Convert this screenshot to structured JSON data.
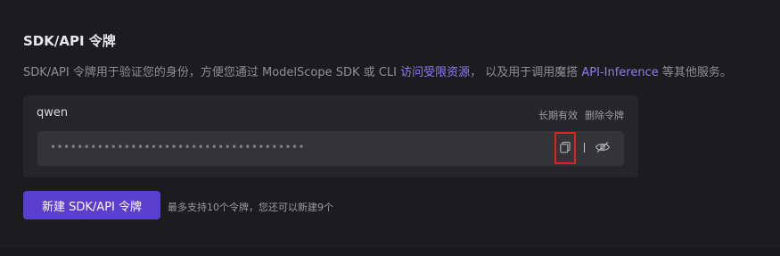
{
  "section": {
    "title": "SDK/API 令牌"
  },
  "description": {
    "part1": "SDK/API 令牌用于验证您的身份，方便您通过 ModelScope SDK 或 CLI ",
    "link1": "访问受限资源",
    "part2": "， 以及用于调用魔搭 ",
    "link2": "API-Inference",
    "part3": " 等其他服务。"
  },
  "token": {
    "name": "qwen",
    "validity_label": "长期有效",
    "delete_label": "删除令牌",
    "masked_value": "••••••••••••••••••••••••••••••••••••••"
  },
  "icons": {
    "copy": "copy-icon",
    "eye": "eye-off-icon"
  },
  "actions": {
    "new_button_label": "新建 SDK/API 令牌",
    "limit_note": "最多支持10个令牌，您还可以新建9个"
  },
  "colors": {
    "accent": "#5a3fcf",
    "link": "#8b7cf6",
    "highlight_box": "#e0201b"
  }
}
